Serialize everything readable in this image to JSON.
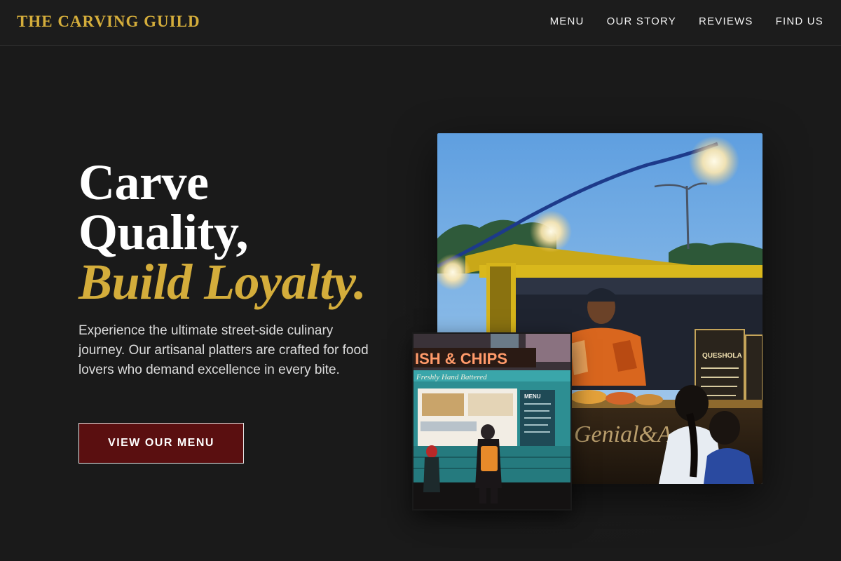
{
  "header": {
    "brand": "THE CARVING GUILD",
    "nav": [
      "MENU",
      "OUR STORY",
      "REVIEWS",
      "FIND US"
    ]
  },
  "hero": {
    "headline_line1": "Carve",
    "headline_line2": "Quality,",
    "headline_accent": "Build Loyalty.",
    "description": "Experience the ultimate street-side culinary journey. Our artisanal platters are crafted for food lovers who demand excellence in every bite.",
    "cta_label": "VIEW OUR MENU"
  },
  "images": {
    "main": {
      "subject": "food-truck-vendor-photo",
      "sign_text": "Genial&A",
      "menu_board_text": "QUESHOLA"
    },
    "inset": {
      "subject": "fish-and-chips-truck-photo",
      "sign_text": "ISH & CHIPS",
      "subtitle_text": "Freshly Hand Battered",
      "menu_text": "MENU"
    }
  },
  "colors": {
    "background": "#1a1a1a",
    "accent_gold": "#d4ad3b",
    "cta_bg": "#5a0f10",
    "text_primary": "#ffffff",
    "text_muted": "#dcdcdc"
  }
}
